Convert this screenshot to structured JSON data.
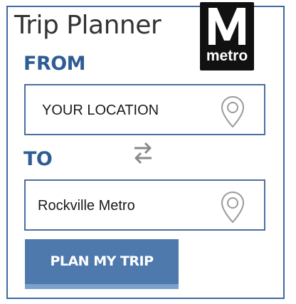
{
  "header": {
    "title": "Trip Planner",
    "logo_text": "metro",
    "logo_icon": "metro-m-logo-icon"
  },
  "from": {
    "label": "FROM",
    "value": "YOUR LOCATION",
    "icon": "location-pin-icon"
  },
  "swap": {
    "icon": "swap-arrows-icon"
  },
  "to": {
    "label": "TO",
    "value": "Rockville Metro",
    "icon": "location-pin-icon"
  },
  "actions": {
    "plan_label": "PLAN MY TRIP"
  },
  "colors": {
    "accent": "#2d5d94",
    "button": "#4d79ad",
    "button_bottom": "#7aa0cc",
    "border": "#3d6aa2"
  }
}
